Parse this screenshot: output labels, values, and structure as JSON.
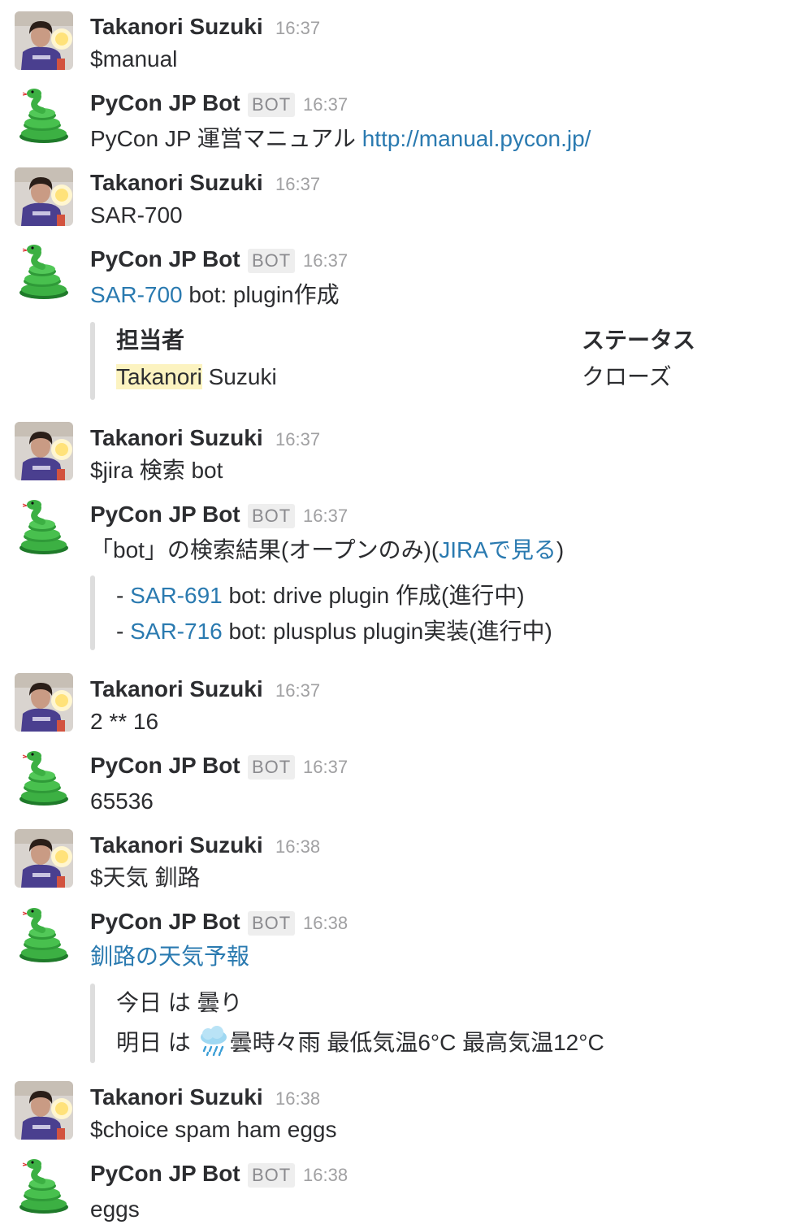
{
  "users": {
    "human": "Takanori Suzuki",
    "bot": "PyCon JP Bot",
    "bot_badge": "BOT"
  },
  "messages": [
    {
      "time": "16:37",
      "text": "$manual"
    },
    {
      "time": "16:37",
      "text_prefix": "PyCon JP 運営マニュアル ",
      "link": "http://manual.pycon.jp/"
    },
    {
      "time": "16:37",
      "text": "SAR-700"
    },
    {
      "time": "16:37",
      "link": "SAR-700",
      "text_suffix": " bot: plugin作成",
      "attachment": {
        "field1_title": "担当者",
        "field1_value_hl": "Takanori",
        "field1_value_rest": " Suzuki",
        "field2_title": "ステータス",
        "field2_value": "クローズ"
      }
    },
    {
      "time": "16:37",
      "text": "$jira 検索 bot"
    },
    {
      "time": "16:37",
      "text_prefix": "「bot」の検索結果(オープンのみ)(",
      "link": "JIRAで見る",
      "text_suffix": ")",
      "attachment": {
        "items": [
          {
            "dash": "- ",
            "link": "SAR-691",
            "text": " bot: drive plugin 作成(進行中)"
          },
          {
            "dash": "- ",
            "link": "SAR-716",
            "text": " bot: plusplus plugin実装(進行中)"
          }
        ]
      }
    },
    {
      "time": "16:37",
      "text": "2 ** 16"
    },
    {
      "time": "16:37",
      "text": "65536"
    },
    {
      "time": "16:38",
      "text": "$天気 釧路"
    },
    {
      "time": "16:38",
      "link": "釧路の天気予報",
      "attachment": {
        "line1": "今日 は 曇り",
        "line2_prefix": "明日 は ",
        "line2_suffix": "曇時々雨 最低気温6°C 最高気温12°C"
      }
    },
    {
      "time": "16:38",
      "text": "$choice spam ham eggs"
    },
    {
      "time": "16:38",
      "text": "eggs"
    }
  ],
  "icons": {
    "human_avatar": "user-avatar",
    "bot_avatar": "snake-emoji",
    "weather": "rain-cloud-emoji"
  }
}
